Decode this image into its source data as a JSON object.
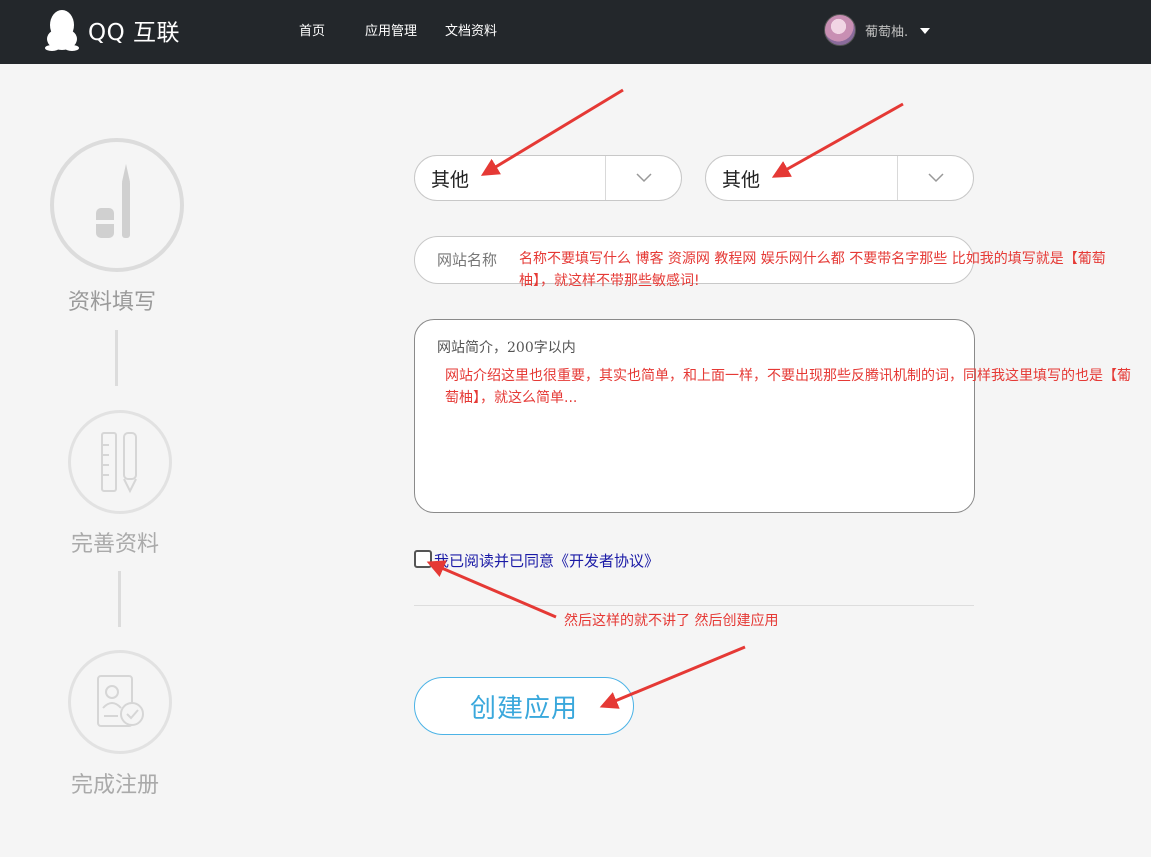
{
  "header": {
    "logo_text": "QQ 互联",
    "nav": [
      "首页",
      "应用管理",
      "文档资料"
    ],
    "user_name": "葡萄柚."
  },
  "steps": [
    {
      "label": "资料填写",
      "icon": "pen-icon"
    },
    {
      "label": "完善资料",
      "icon": "ruler-pencil-icon"
    },
    {
      "label": "完成注册",
      "icon": "id-card-check-icon"
    }
  ],
  "form": {
    "select1_value": "其他",
    "select2_value": "其他",
    "site_name_placeholder": "网站名称",
    "site_intro_placeholder": "网站简介，200字以内",
    "agree_text": "我已阅读并已同意《开发者协议》",
    "create_button": "创建应用"
  },
  "annotations": {
    "name_note": "名称不要填写什么 博客 资源网 教程网 娱乐网什么都 不要带名字那些  比如我的填写就是【葡萄柚】，就这样不带那些敏感词!",
    "intro_note": "网站介绍这里也很重要，其实也简单，和上面一样，不要出现那些反腾讯机制的词，同样我这里填写的也是【葡萄柚】，就这么简单...",
    "agree_note": "然后这样的就不讲了 然后创建应用"
  },
  "colors": {
    "header_bg": "#23272b",
    "accent_blue": "#3aa8dc",
    "annotation_red": "#e53935"
  }
}
